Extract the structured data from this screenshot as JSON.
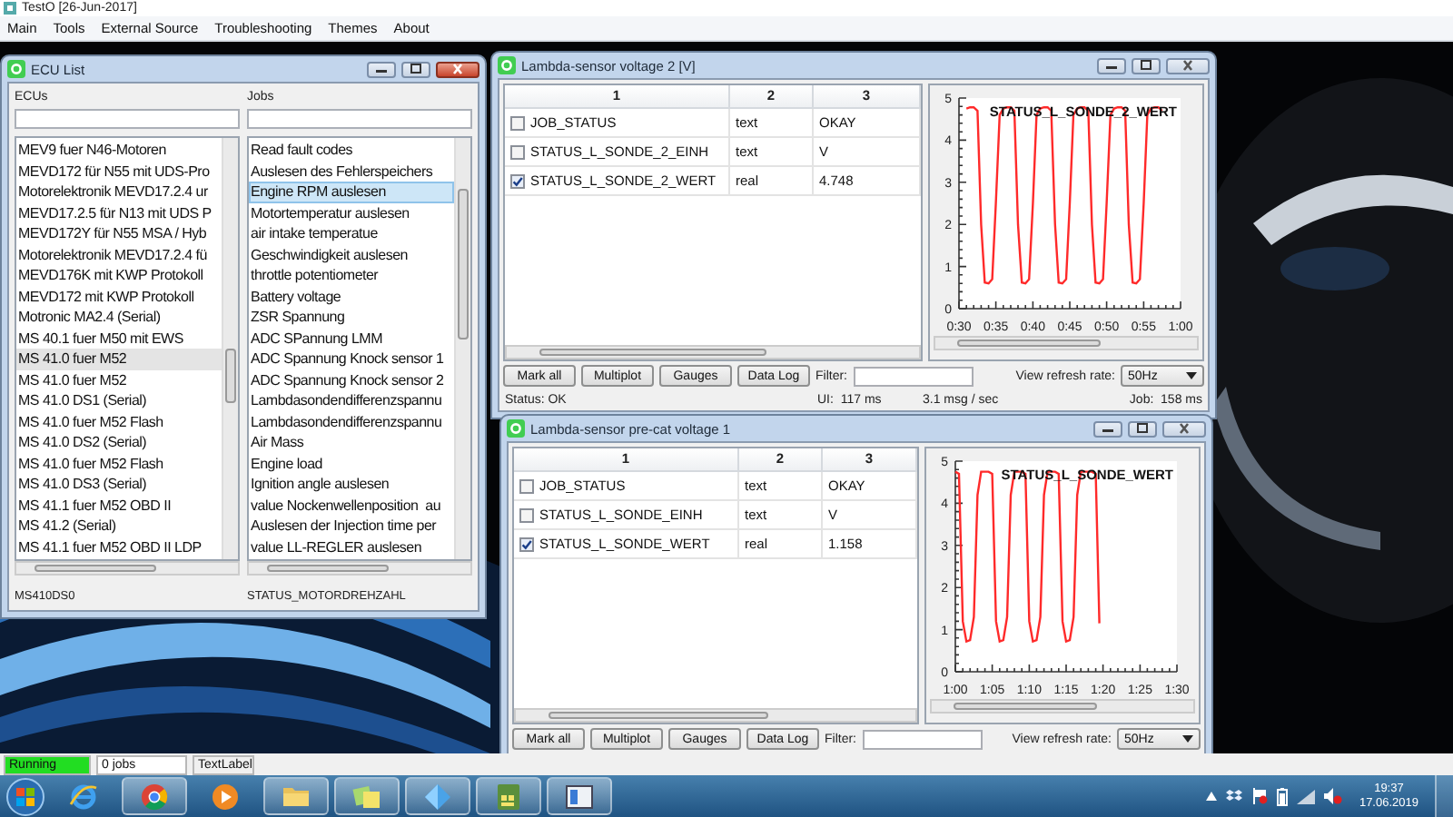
{
  "app": {
    "title": "TestO [26-Jun-2017]",
    "menu": [
      "Main",
      "Tools",
      "External Source",
      "Troubleshooting",
      "Themes",
      "About"
    ]
  },
  "ecu_window": {
    "title": "ECU List",
    "active": true,
    "ecus": {
      "label": "ECUs",
      "status": "MS410DS0",
      "items": [
        {
          "text": "MEV9 fuer N46-Motoren",
          "selected": false
        },
        {
          "text": "MEVD172 für N55 mit UDS-Pro",
          "selected": false
        },
        {
          "text": "Motorelektronik MEVD17.2.4 ur",
          "selected": false
        },
        {
          "text": "MEVD17.2.5 für N13 mit UDS P",
          "selected": false
        },
        {
          "text": "MEVD172Y für N55 MSA / Hyb",
          "selected": false
        },
        {
          "text": "Motorelektronik MEVD17.2.4 fü",
          "selected": false
        },
        {
          "text": "MEVD176K mit KWP Protokoll",
          "selected": false
        },
        {
          "text": "MEVD172 mit KWP Protokoll",
          "selected": false
        },
        {
          "text": "Motronic MA2.4 (Serial)",
          "selected": false
        },
        {
          "text": "MS 40.1 fuer M50 mit EWS",
          "selected": false
        },
        {
          "text": "MS 41.0 fuer M52",
          "selected": true
        },
        {
          "text": "MS 41.0 fuer M52",
          "selected": false
        },
        {
          "text": "MS 41.0 DS1 (Serial)",
          "selected": false
        },
        {
          "text": "MS 41.0 fuer M52 Flash",
          "selected": false
        },
        {
          "text": "MS 41.0 DS2 (Serial)",
          "selected": false
        },
        {
          "text": "MS 41.0 fuer M52 Flash",
          "selected": false
        },
        {
          "text": "MS 41.0 DS3 (Serial)",
          "selected": false
        },
        {
          "text": "MS 41.1 fuer M52 OBD II",
          "selected": false
        },
        {
          "text": "MS 41.2 (Serial)",
          "selected": false
        },
        {
          "text": "MS 41.1 fuer M52 OBD II LDP",
          "selected": false
        }
      ]
    },
    "jobs": {
      "label": "Jobs",
      "status": "STATUS_MOTORDREHZAHL",
      "items": [
        {
          "text": "Read fault codes",
          "selected": false
        },
        {
          "text": "Auslesen des Fehlerspeichers",
          "selected": false
        },
        {
          "text": "Engine RPM auslesen",
          "selected": true
        },
        {
          "text": "Motortemperatur auslesen",
          "selected": false
        },
        {
          "text": "air intake temperatue",
          "selected": false
        },
        {
          "text": "Geschwindigkeit auslesen",
          "selected": false
        },
        {
          "text": "throttle potentiometer",
          "selected": false
        },
        {
          "text": "Battery voltage",
          "selected": false
        },
        {
          "text": "ZSR Spannung",
          "selected": false
        },
        {
          "text": "ADC SPannung LMM",
          "selected": false
        },
        {
          "text": "ADC Spannung Knock sensor 1",
          "selected": false
        },
        {
          "text": "ADC Spannung Knock sensor 2",
          "selected": false
        },
        {
          "text": "Lambdasondendifferenzspannu",
          "selected": false
        },
        {
          "text": "Lambdasondendifferenzspannu",
          "selected": false
        },
        {
          "text": "Air Mass",
          "selected": false
        },
        {
          "text": "Engine load",
          "selected": false
        },
        {
          "text": "Ignition angle auslesen",
          "selected": false
        },
        {
          "text": "value Nockenwellenposition  au",
          "selected": false
        },
        {
          "text": "Auslesen der Injection time per",
          "selected": false
        },
        {
          "text": "value LL-REGLER auslesen",
          "selected": false
        }
      ]
    }
  },
  "sensor_windows": [
    {
      "title": "Lambda-sensor voltage 2 [V]",
      "active": false,
      "columns": [
        "1",
        "2",
        "3"
      ],
      "rows": [
        {
          "name": "JOB_STATUS",
          "type": "text",
          "value": "OKAY",
          "checked": false
        },
        {
          "name": "STATUS_L_SONDE_2_EINH",
          "type": "text",
          "value": "V",
          "checked": false
        },
        {
          "name": "STATUS_L_SONDE_2_WERT",
          "type": "real",
          "value": "4.748",
          "checked": true
        }
      ],
      "buttons": [
        "Mark all",
        "Multiplot",
        "Gauges",
        "Data Log"
      ],
      "filter_label": "Filter:",
      "refresh_label": "View refresh rate:",
      "refresh_value": "50Hz",
      "status": {
        "text": "Status: OK",
        "ui": "UI:  117 ms",
        "rate": "3.1 msg / sec",
        "job": "Job:  158 ms"
      },
      "chart_data": {
        "type": "line",
        "xlim": [
          30,
          60
        ],
        "ylim": [
          0,
          5
        ],
        "yticks": [
          0,
          1,
          2,
          3,
          4,
          5
        ],
        "xticks": [
          {
            "value": 30,
            "label": "0:30"
          },
          {
            "value": 35,
            "label": "0:35"
          },
          {
            "value": 40,
            "label": "0:40"
          },
          {
            "value": 45,
            "label": "0:45"
          },
          {
            "value": 50,
            "label": "0:50"
          },
          {
            "value": 55,
            "label": "0:55"
          },
          {
            "value": 60,
            "label": "1:00"
          }
        ],
        "x": [
          31,
          31.5,
          32,
          32.5,
          33,
          33.5,
          34,
          34.5,
          35,
          35.5,
          36,
          36.5,
          37,
          37.5,
          38,
          38.5,
          39,
          39.5,
          40,
          40.5,
          41,
          41.5,
          42,
          42.5,
          43,
          43.5,
          44,
          44.5,
          45,
          45.5,
          46,
          46.5,
          47,
          47.5,
          48,
          48.5,
          49,
          49.5,
          50,
          50.5,
          51,
          51.5,
          52,
          52.5,
          53,
          53.5,
          54,
          54.5,
          55,
          55.5,
          56,
          56.5,
          57,
          57.5
        ],
        "series": [
          {
            "name": "STATUS_L_SONDE_2_WERT",
            "color": "#ff2a2a",
            "values": [
              4.75,
              4.78,
              4.78,
              4.7,
              2.0,
              0.62,
              0.6,
              0.7,
              2.5,
              4.6,
              4.75,
              4.78,
              4.78,
              4.7,
              2.0,
              0.62,
              0.6,
              0.7,
              2.5,
              4.6,
              4.75,
              4.78,
              4.78,
              4.7,
              2.0,
              0.62,
              0.6,
              0.7,
              2.5,
              4.6,
              4.75,
              4.78,
              4.78,
              4.7,
              2.0,
              0.62,
              0.6,
              0.7,
              2.5,
              4.6,
              4.75,
              4.78,
              4.78,
              4.7,
              2.0,
              0.62,
              0.6,
              0.7,
              2.5,
              4.6,
              4.75,
              4.78,
              4.78,
              4.7
            ]
          }
        ]
      }
    },
    {
      "title": "Lambda-sensor pre-cat voltage 1",
      "active": false,
      "columns": [
        "1",
        "2",
        "3"
      ],
      "rows": [
        {
          "name": "JOB_STATUS",
          "type": "text",
          "value": "OKAY",
          "checked": false
        },
        {
          "name": "STATUS_L_SONDE_EINH",
          "type": "text",
          "value": "V",
          "checked": false
        },
        {
          "name": "STATUS_L_SONDE_WERT",
          "type": "real",
          "value": "1.158",
          "checked": true
        }
      ],
      "buttons": [
        "Mark all",
        "Multiplot",
        "Gauges",
        "Data Log"
      ],
      "filter_label": "Filter:",
      "refresh_label": "View refresh rate:",
      "refresh_value": "50Hz",
      "chart_data": {
        "type": "line",
        "xlim": [
          60,
          90
        ],
        "ylim": [
          0,
          5
        ],
        "yticks": [
          0,
          1,
          2,
          3,
          4,
          5
        ],
        "xticks": [
          {
            "value": 60,
            "label": "1:00"
          },
          {
            "value": 65,
            "label": "1:05"
          },
          {
            "value": 70,
            "label": "1:10"
          },
          {
            "value": 75,
            "label": "1:15"
          },
          {
            "value": 80,
            "label": "1:20"
          },
          {
            "value": 85,
            "label": "1:25"
          },
          {
            "value": 90,
            "label": "1:30"
          }
        ],
        "x": [
          60,
          60.5,
          61,
          61.5,
          62,
          62.5,
          63,
          63.5,
          64,
          64.5,
          65,
          65.5,
          66,
          66.5,
          67,
          67.5,
          68,
          68.5,
          69,
          69.5,
          70,
          70.5,
          71,
          71.5,
          72,
          72.5,
          73,
          73.5,
          74,
          74.5,
          75,
          75.5,
          76,
          76.5,
          77,
          77.5,
          78,
          78.5,
          79,
          79.5
        ],
        "series": [
          {
            "name": "STATUS_L_SONDE_WERT",
            "color": "#ff2a2a",
            "values": [
              4.75,
              4.7,
              1.2,
              0.72,
              0.75,
              1.3,
              4.2,
              4.75,
              4.75,
              4.75,
              4.7,
              1.2,
              0.72,
              0.75,
              1.3,
              4.2,
              4.75,
              4.75,
              4.75,
              4.7,
              1.2,
              0.72,
              0.75,
              1.3,
              4.2,
              4.75,
              4.75,
              4.75,
              4.7,
              1.2,
              0.72,
              0.75,
              1.3,
              4.2,
              4.75,
              4.75,
              4.75,
              4.75,
              4.7,
              1.15
            ]
          }
        ]
      }
    }
  ],
  "status_bar": {
    "state": "Running",
    "jobs": "0 jobs",
    "label": "TextLabel"
  },
  "taskbar": {
    "apps": [
      {
        "kind": "globe",
        "open": false
      },
      {
        "kind": "wheel",
        "open": true
      },
      {
        "kind": "player",
        "open": false
      },
      {
        "kind": "folder",
        "open": true
      },
      {
        "kind": "notes",
        "open": true
      },
      {
        "kind": "diamond",
        "open": true
      },
      {
        "kind": "tiles",
        "open": true
      },
      {
        "kind": "window",
        "open": true
      }
    ],
    "time": "19:37",
    "date": "17.06.2019"
  }
}
